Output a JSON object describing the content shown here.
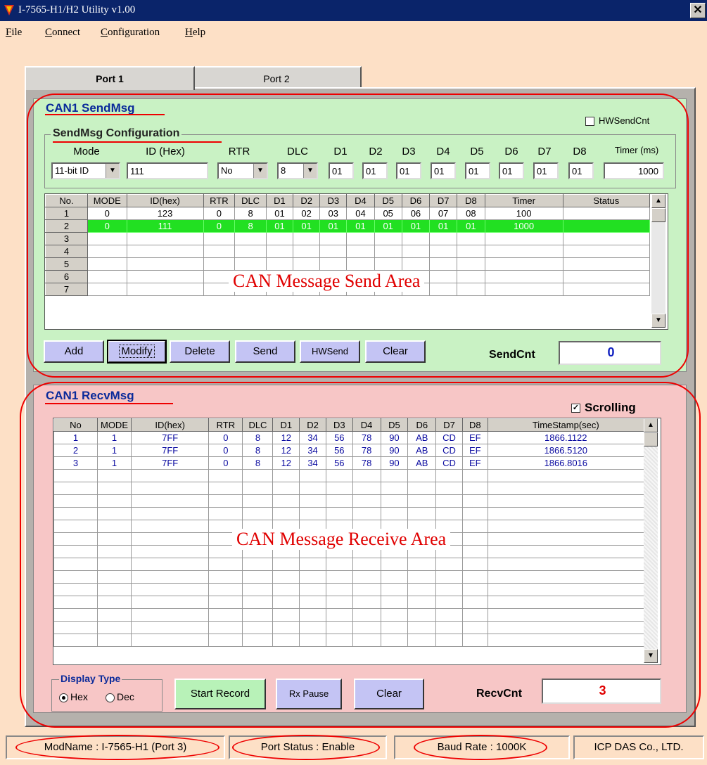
{
  "window": {
    "title": "I-7565-H1/H2 Utility v1.00",
    "close": "✕"
  },
  "menu": [
    "File",
    "Connect",
    "Configuration",
    "Help"
  ],
  "tabs": [
    "Port 1",
    "Port 2"
  ],
  "send": {
    "title": "CAN1 SendMsg",
    "hwsendcnt_label": "HWSendCnt",
    "config_title": "SendMsg Configuration",
    "headers": {
      "mode": "Mode",
      "id": "ID (Hex)",
      "rtr": "RTR",
      "dlc": "DLC",
      "d1": "D1",
      "d2": "D2",
      "d3": "D3",
      "d4": "D4",
      "d5": "D5",
      "d6": "D6",
      "d7": "D7",
      "d8": "D8",
      "timer": "Timer (ms)"
    },
    "values": {
      "mode": "11-bit ID",
      "id": "111",
      "rtr": "No",
      "dlc": "8",
      "d1": "01",
      "d2": "01",
      "d3": "01",
      "d4": "01",
      "d5": "01",
      "d6": "01",
      "d7": "01",
      "d8": "01",
      "timer": "1000"
    },
    "columns": [
      "No.",
      "MODE",
      "ID(hex)",
      "RTR",
      "DLC",
      "D1",
      "D2",
      "D3",
      "D4",
      "D5",
      "D6",
      "D7",
      "D8",
      "Timer",
      "Status"
    ],
    "rows": [
      [
        "1",
        "0",
        "123",
        "0",
        "8",
        "01",
        "02",
        "03",
        "04",
        "05",
        "06",
        "07",
        "08",
        "100",
        ""
      ],
      [
        "2",
        "0",
        "111",
        "0",
        "8",
        "01",
        "01",
        "01",
        "01",
        "01",
        "01",
        "01",
        "01",
        "1000",
        ""
      ],
      [
        "3",
        "",
        "",
        "",
        "",
        "",
        "",
        "",
        "",
        "",
        "",
        "",
        "",
        "",
        ""
      ],
      [
        "4",
        "",
        "",
        "",
        "",
        "",
        "",
        "",
        "",
        "",
        "",
        "",
        "",
        "",
        ""
      ],
      [
        "5",
        "",
        "",
        "",
        "",
        "",
        "",
        "",
        "",
        "",
        "",
        "",
        "",
        "",
        ""
      ],
      [
        "6",
        "",
        "",
        "",
        "",
        "",
        "",
        "",
        "",
        "",
        "",
        "",
        "",
        "",
        ""
      ],
      [
        "7",
        "",
        "",
        "",
        "",
        "",
        "",
        "",
        "",
        "",
        "",
        "",
        "",
        "",
        ""
      ]
    ],
    "overlay": "CAN Message Send Area",
    "buttons": {
      "add": "Add",
      "modify": "Modify",
      "delete": "Delete",
      "send": "Send",
      "hwsend": "HWSend",
      "clear": "Clear"
    },
    "sendcnt_label": "SendCnt",
    "sendcnt_value": "0"
  },
  "recv": {
    "title": "CAN1 RecvMsg",
    "scrolling_label": "Scrolling",
    "columns": [
      "No",
      "MODE",
      "ID(hex)",
      "RTR",
      "DLC",
      "D1",
      "D2",
      "D3",
      "D4",
      "D5",
      "D6",
      "D7",
      "D8",
      "TimeStamp(sec)"
    ],
    "rows": [
      [
        "1",
        "1",
        "7FF",
        "0",
        "8",
        "12",
        "34",
        "56",
        "78",
        "90",
        "AB",
        "CD",
        "EF",
        "1866.1122"
      ],
      [
        "2",
        "1",
        "7FF",
        "0",
        "8",
        "12",
        "34",
        "56",
        "78",
        "90",
        "AB",
        "CD",
        "EF",
        "1866.5120"
      ],
      [
        "3",
        "1",
        "7FF",
        "0",
        "8",
        "12",
        "34",
        "56",
        "78",
        "90",
        "AB",
        "CD",
        "EF",
        "1866.8016"
      ]
    ],
    "overlay": "CAN Message Receive Area",
    "display_type": {
      "title": "Display Type",
      "hex": "Hex",
      "dec": "Dec"
    },
    "buttons": {
      "start_record": "Start Record",
      "rx_pause": "Rx Pause",
      "clear": "Clear"
    },
    "recvcnt_label": "RecvCnt",
    "recvcnt_value": "3"
  },
  "status": {
    "modname": "ModName : I-7565-H1 (Port 3)",
    "port_status": "Port Status : Enable",
    "baud": "Baud Rate : 1000K",
    "company": "ICP DAS Co., LTD."
  },
  "colors": {
    "send_bg": "#c9f2c4",
    "recv_bg": "#f7c6c6",
    "highlight_row": "#22e022",
    "annotation_red": "#e00000"
  }
}
